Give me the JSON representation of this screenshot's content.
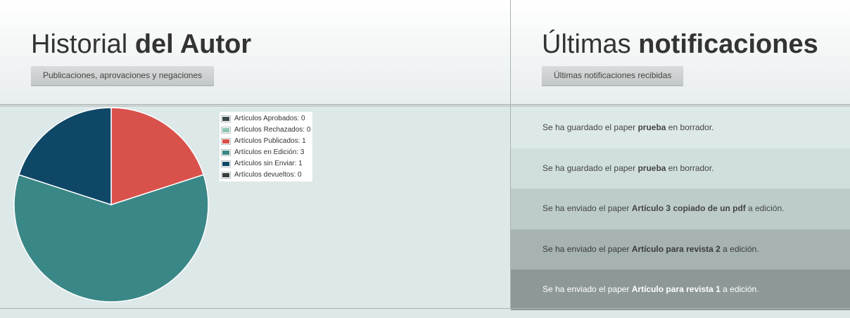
{
  "left": {
    "title_normal": "Historial",
    "title_bold": "del Autor",
    "subtitle": "Publicaciones, aprovaciones y negaciones"
  },
  "right": {
    "title_normal": "Últimas",
    "title_bold": "notificaciones",
    "subtitle": "Últimas notificaciones recibidas"
  },
  "chart_data": {
    "type": "pie",
    "slices": [
      {
        "label": "Artículos Aprobados: 0",
        "value": 0,
        "color": "#3d4a4d"
      },
      {
        "label": "Artículos Rechazados: 0",
        "value": 0,
        "color": "#8cc4b2"
      },
      {
        "label": "Artículos Publicados: 1",
        "value": 1,
        "color": "#d9514b"
      },
      {
        "label": "Artículos en Edición: 3",
        "value": 3,
        "color": "#3a8787"
      },
      {
        "label": "Artículos sin Enviar: 1",
        "value": 1,
        "color": "#0f4766"
      },
      {
        "label": "Artículos devueltos: 0",
        "value": 0,
        "color": "#3a3f40"
      }
    ],
    "legend_position": "top-right"
  },
  "notifications": [
    {
      "prefix": "Se ha guardado el paper",
      "paper": "prueba",
      "suffix": "en borrador.",
      "bg": "#dde8e8",
      "color": "#444444"
    },
    {
      "prefix": "Se ha guardado el paper",
      "paper": "prueba",
      "suffix": "en borrador.",
      "bg": "#d0dfde",
      "color": "#444444"
    },
    {
      "prefix": "Se ha enviado el paper",
      "paper": "Artículo 3 copiado de un pdf",
      "suffix": "a edición.",
      "bg": "#bdcccb",
      "color": "#444444"
    },
    {
      "prefix": "Se ha enviado el paper",
      "paper": "Artículo para revista 2",
      "suffix": "a edición.",
      "bg": "#a7b3b3",
      "color": "#3a3a3a"
    },
    {
      "prefix": "Se ha enviado el paper",
      "paper": "Artículo para revista 1",
      "suffix": "a edición.",
      "bg": "#8e9898",
      "color": "#ffffff"
    }
  ]
}
